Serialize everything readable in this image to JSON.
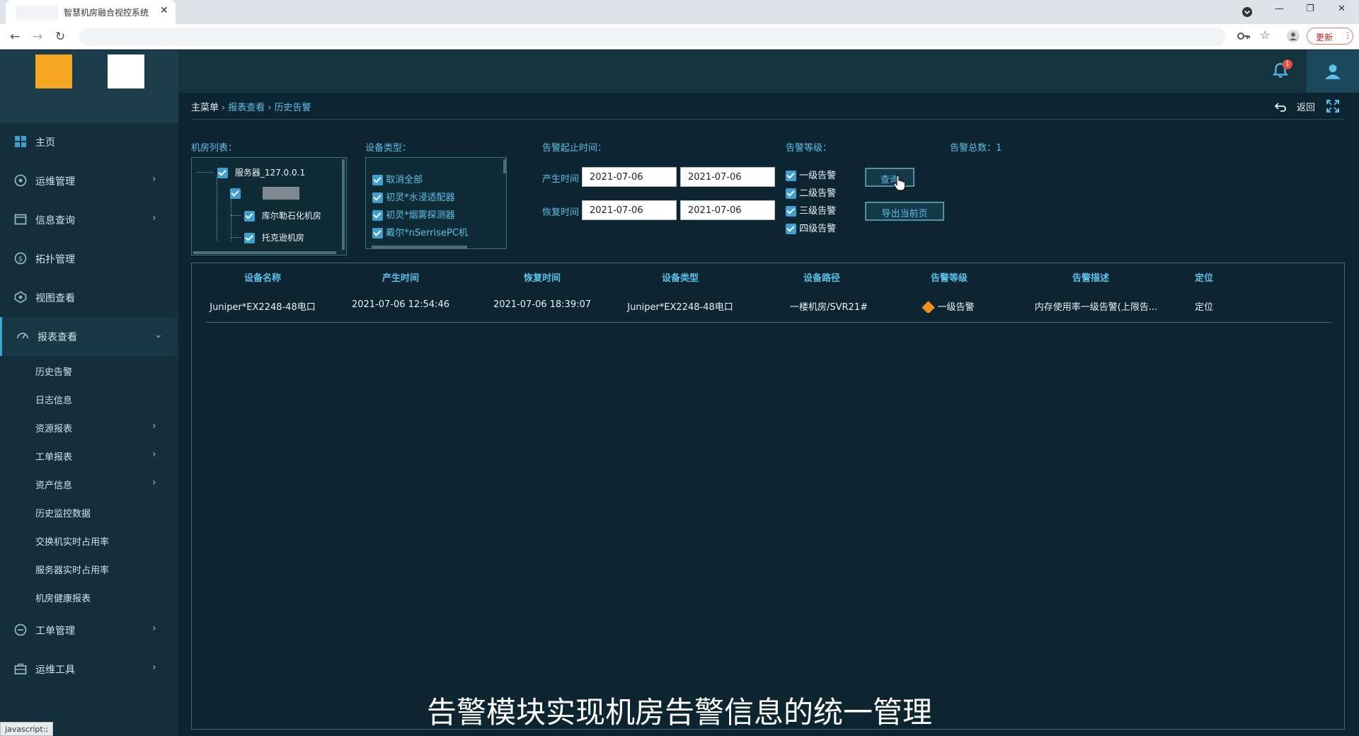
{
  "browser": {
    "tab_title": "智慧机房融合视控系统",
    "tab_close": "✕",
    "update_label": "更新",
    "window_controls": {
      "minimize": "—",
      "restore": "❐",
      "close": "✕"
    }
  },
  "header": {
    "notification_count": "1"
  },
  "sidebar": {
    "items": [
      {
        "label": "主页",
        "icon": "home-icon",
        "has_arrow": false
      },
      {
        "label": "运维管理",
        "icon": "ops-icon",
        "has_arrow": true
      },
      {
        "label": "信息查询",
        "icon": "info-icon",
        "has_arrow": true
      },
      {
        "label": "拓扑管理",
        "icon": "topology-icon",
        "has_arrow": false
      },
      {
        "label": "视图查看",
        "icon": "view-icon",
        "has_arrow": false
      },
      {
        "label": "报表查看",
        "icon": "report-icon",
        "has_arrow": true,
        "expanded": true
      }
    ],
    "sub_items": [
      {
        "label": "历史告警",
        "has_arrow": false
      },
      {
        "label": "日志信息",
        "has_arrow": false
      },
      {
        "label": "资源报表",
        "has_arrow": true
      },
      {
        "label": "工单报表",
        "has_arrow": true
      },
      {
        "label": "资产信息",
        "has_arrow": true
      },
      {
        "label": "历史监控数据",
        "has_arrow": false
      },
      {
        "label": "交换机实时占用率",
        "has_arrow": false
      },
      {
        "label": "服务器实时占用率",
        "has_arrow": false
      },
      {
        "label": "机房健康报表",
        "has_arrow": false
      }
    ],
    "bottom_items": [
      {
        "label": "工单管理",
        "icon": "workorder-icon",
        "has_arrow": true
      },
      {
        "label": "运维工具",
        "icon": "toolbox-icon",
        "has_arrow": true
      }
    ]
  },
  "breadcrumb": {
    "root": "主菜单",
    "level1": "报表查看",
    "level2": "历史告警",
    "sep": "›"
  },
  "toolbar": {
    "back_label": "返回"
  },
  "filters": {
    "room_list_label": "机房列表：",
    "room_tree": {
      "server": "服务器_127.0.0.1",
      "rooms": [
        "库尔勒石化机房",
        "托克逊机房"
      ]
    },
    "device_type_label": "设备类型：",
    "device_types": [
      "取消全部",
      "初灵*水浸适配器",
      "初灵*烟雾探测器",
      "戴尔*nSerrisePC机"
    ],
    "time_range_label": "告警起止时间：",
    "occur_time_label": "产生时间",
    "recover_time_label": "恢复时间",
    "occur_start": "2021-07-06",
    "occur_end": "2021-07-06",
    "recover_start": "2021-07-06",
    "recover_end": "2021-07-06",
    "level_label": "告警等级：",
    "levels": [
      "一级告警",
      "二级告警",
      "三级告警",
      "四级告警"
    ],
    "query_button": "查询",
    "export_button": "导出当前页",
    "total_label": "告警总数：1"
  },
  "table": {
    "headers": [
      "设备名称",
      "产生时间",
      "恢复时间",
      "设备类型",
      "设备路径",
      "告警等级",
      "告警描述",
      "定位"
    ],
    "rows": [
      {
        "device_name": "Juniper*EX2248-48电口",
        "occur_time": "2021-07-06 12:54:46",
        "recover_time": "2021-07-06 18:39:07",
        "device_type": "Juniper*EX2248-48电口",
        "device_path": "一楼机房/SVR21#",
        "level": "一级告警",
        "description": "内存使用率一级告警(上限告...",
        "locate": "定位"
      }
    ]
  },
  "colors": {
    "level1_marker": "#f28e1c",
    "accent": "#5dc0ea"
  },
  "subtitle": "告警模块实现机房告警信息的统一管理",
  "status_tip": "javascript:;"
}
